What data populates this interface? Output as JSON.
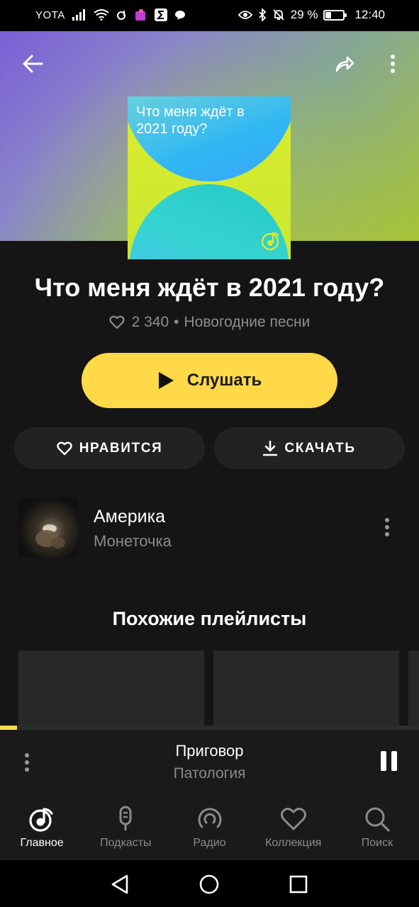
{
  "status_bar": {
    "carrier": "YOTA",
    "battery": "29 %",
    "battery_level": 0.29,
    "time": "12:40"
  },
  "playlist": {
    "cover_title": "Что меня ждёт в 2021 году?",
    "title": "Что меня ждёт в 2021 году?",
    "likes": "2 340",
    "separator": "•",
    "category": "Новогодние песни"
  },
  "actions": {
    "play_label": "Слушать",
    "like_label": "НРАВИТСЯ",
    "download_label": "СКАЧАТЬ"
  },
  "tracks": [
    {
      "title": "Америка",
      "artist": "Монеточка"
    }
  ],
  "similar": {
    "heading": "Похожие плейлисты"
  },
  "now_playing": {
    "title": "Приговор",
    "artist": "Патология",
    "progress": 0.04
  },
  "tabs": [
    {
      "label": "Главное",
      "icon": "home-music-icon",
      "active": true
    },
    {
      "label": "Подкасты",
      "icon": "microphone-icon",
      "active": false
    },
    {
      "label": "Радио",
      "icon": "radio-icon",
      "active": false
    },
    {
      "label": "Коллекция",
      "icon": "heart-icon",
      "active": false
    },
    {
      "label": "Поиск",
      "icon": "search-icon",
      "active": false
    }
  ],
  "colors": {
    "accent": "#ffd947",
    "background": "#151515",
    "muted_text": "#8e8e8e"
  }
}
